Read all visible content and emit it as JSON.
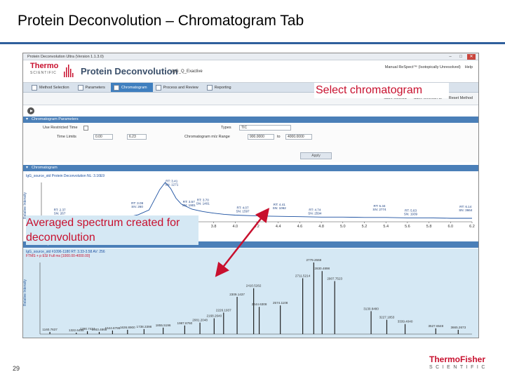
{
  "slide": {
    "title": "Protein Deconvolution – Chromatogram Tab",
    "page_number": "29",
    "footer_logo": {
      "top": "ThermoFisher",
      "bottom": "SCIENTIFIC"
    }
  },
  "app": {
    "window_title": "Protein Deconvolution Ultra (Version 1.1.3.0)",
    "window_buttons": [
      "–",
      "□",
      "✕"
    ],
    "logo_top": "Thermo",
    "logo_bottom": "SCIENTIFIC",
    "name": "Protein Deconvolution",
    "method_name": "IgG_Q_Exactive",
    "header_right": [
      "Manual ReSpect™ (Isotopically Unresolved)",
      "Help"
    ],
    "tabs": [
      {
        "label": "Method Selection",
        "active": false
      },
      {
        "label": "Parameters",
        "active": false
      },
      {
        "label": "Chromatogram",
        "active": true
      },
      {
        "label": "Process and Review",
        "active": false
      },
      {
        "label": "Reporting",
        "active": false
      }
    ],
    "actions": [
      "Save Method",
      "Save Method As",
      "Reset Method"
    ],
    "sections": {
      "params": "Chromatogram Parameters",
      "chromatogram": "Chromatogram",
      "spectrum": "Source Spectrum"
    },
    "params": {
      "use_restricted_time": "Use Restricted Time",
      "time_limits": "Time Limits",
      "time_from": "0.00",
      "time_to": "6.23",
      "types_label": "Types",
      "types_value": "TIC",
      "mz_range_label": "Chromatogram m/z Range",
      "mz_from": "900.0000",
      "mz_to_label": "to",
      "mz_to": "4000.0000",
      "apply": "Apply"
    },
    "chrom_info": "IgG_source_std   Protein Deconvolution   NL: 3.16E9",
    "chrom_ylabel": "Relative Intensity",
    "chrom_xlabel": "Time (min)",
    "spec_info_1": "IgG_source_std #1096-1180  RT: 3.33-3.58  AV: 256",
    "spec_info_2": "FTMS + p ESI Full ms [1000.00-4000.00]",
    "spec_ylabel": "Relative Intensity"
  },
  "callouts": {
    "select": "Select chromatogram",
    "averaged": "Averaged spectrum created for deconvolution"
  },
  "chart_data": [
    {
      "type": "line",
      "title": "",
      "xlabel": "Time (min)",
      "ylabel": "Relative Intensity",
      "xlim": [
        2.2,
        6.2
      ],
      "ylim": [
        0,
        100
      ],
      "x_ticks": [
        "2.2",
        "2.4",
        "2.6",
        "2.8",
        "3.0",
        "3.2",
        "3.4",
        "3.6",
        "3.8",
        "4.0",
        "4.2",
        "4.4",
        "4.6",
        "4.8",
        "5.0",
        "5.2",
        "5.4",
        "5.6",
        "5.8",
        "6.0",
        "6.2"
      ],
      "x": [
        2.2,
        2.3,
        2.4,
        2.5,
        2.6,
        2.7,
        2.8,
        2.9,
        3.0,
        3.1,
        3.2,
        3.3,
        3.35,
        3.4,
        3.45,
        3.5,
        3.6,
        3.7,
        3.8,
        3.9,
        4.0,
        4.2,
        4.4,
        4.6,
        4.8,
        5.0,
        5.2,
        5.4,
        5.6,
        5.8,
        6.0,
        6.2
      ],
      "values": [
        10,
        8,
        12,
        9,
        11,
        10,
        9,
        13,
        12,
        18,
        30,
        82,
        100,
        85,
        60,
        45,
        32,
        26,
        22,
        19,
        17,
        15,
        14,
        13,
        12,
        12,
        11,
        11,
        10,
        10,
        9,
        9
      ],
      "annotations": [
        {
          "x": 3.41,
          "label": "RT: 3.41 SN: 1271"
        },
        {
          "x": 3.7,
          "label": "RT: 3.70 SN: 1401"
        },
        {
          "x": 3.57,
          "label": "RT: 3.57 SN: 1901"
        },
        {
          "x": 3.09,
          "label": "RT: 3.09 SN: 260"
        },
        {
          "x": 4.07,
          "label": "RT: 4.07 SN: 1597"
        },
        {
          "x": 4.41,
          "label": "RT: 4.41 SN: 1062"
        },
        {
          "x": 4.74,
          "label": "RT: 4.74 SN: 2594"
        },
        {
          "x": 5.34,
          "label": "RT: 5.34 SN: 2774"
        },
        {
          "x": 5.63,
          "label": "RT: 5.63 SN: 1939"
        },
        {
          "x": 6.14,
          "label": "RT: 6.14 SN: 3664"
        },
        {
          "x": 2.37,
          "label": "RT: 2.37 SN: 267"
        }
      ]
    },
    {
      "type": "bar",
      "title": "",
      "xlabel": "m/z",
      "ylabel": "Relative Intensity",
      "ylim": [
        0,
        100
      ],
      "x": [
        1160.7637,
        1322.6485,
        1390.7424,
        1463.4865,
        1544.8798,
        1636.89,
        1738.3398,
        1855.5196,
        1987.876,
        2081.2048,
        2168.264,
        2226.1937,
        2309.1437,
        2410.5262,
        2444.6308,
        2574.1108,
        2711.5214,
        2779.2668,
        2830.4898,
        2907.7523,
        3130.848,
        3227.1853,
        3339.404,
        3527.6548,
        3665.2673
      ],
      "values": [
        3,
        2,
        4,
        3,
        5,
        6,
        7,
        9,
        12,
        16,
        22,
        30,
        52,
        64,
        38,
        40,
        78,
        100,
        88,
        74,
        32,
        20,
        14,
        8,
        6
      ],
      "labels": [
        "1160.7637",
        "1322.6485",
        "1390.7424",
        "1463.4865",
        "1544.8798",
        "1636.8900",
        "1738.3398",
        "1855.5196",
        "1987.8760",
        "2081.2048",
        "2168.2640",
        "2226.1937",
        "2309.1437",
        "2410.5262",
        "2444.6308",
        "2574.1108",
        "2711.5214",
        "2779.2668",
        "2830.4898",
        "2907.7523",
        "3130.8480",
        "3227.1853",
        "3339.4040",
        "3527.6548",
        "3665.2673"
      ]
    }
  ],
  "colors": {
    "accent_red": "#c8102e",
    "header_blue": "#4a7fb8",
    "trace_blue": "#1a4fa0",
    "spectrum_bg": "#d5e8f4",
    "title_rule": "#2f5f9c"
  }
}
